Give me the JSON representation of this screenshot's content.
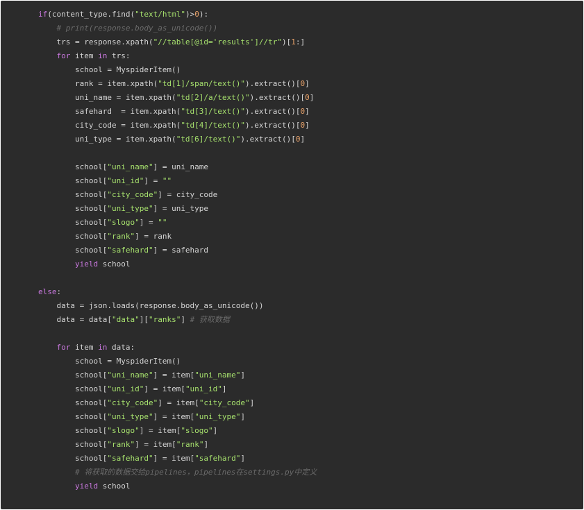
{
  "colors": {
    "background": "#2b2b2b",
    "plain": "#d4d4d4",
    "keyword": "#c777dc",
    "string": "#a6e06d",
    "number": "#e8a26a",
    "comment": "#6a6a6a"
  },
  "code_lines": [
    [
      [
        "keyword",
        "if"
      ],
      [
        "plain",
        "(content_type.find("
      ],
      [
        "string",
        "\"text/html\""
      ],
      [
        "plain",
        ")>"
      ],
      [
        "number",
        "0"
      ],
      [
        "plain",
        "):"
      ]
    ],
    [
      [
        "plain",
        "    "
      ],
      [
        "comment",
        "# print(response.body_as_unicode())"
      ]
    ],
    [
      [
        "plain",
        "    trs = response.xpath("
      ],
      [
        "string",
        "\"//table[@id='results']//tr\""
      ],
      [
        "plain",
        ")["
      ],
      [
        "number",
        "1"
      ],
      [
        "plain",
        ":]"
      ]
    ],
    [
      [
        "plain",
        "    "
      ],
      [
        "keyword",
        "for"
      ],
      [
        "plain",
        " item "
      ],
      [
        "keyword",
        "in"
      ],
      [
        "plain",
        " trs:"
      ]
    ],
    [
      [
        "plain",
        "        school = MyspiderItem()"
      ]
    ],
    [
      [
        "plain",
        "        rank = item.xpath("
      ],
      [
        "string",
        "\"td[1]/span/text()\""
      ],
      [
        "plain",
        ").extract()["
      ],
      [
        "number",
        "0"
      ],
      [
        "plain",
        "]"
      ]
    ],
    [
      [
        "plain",
        "        uni_name = item.xpath("
      ],
      [
        "string",
        "\"td[2]/a/text()\""
      ],
      [
        "plain",
        ").extract()["
      ],
      [
        "number",
        "0"
      ],
      [
        "plain",
        "]"
      ]
    ],
    [
      [
        "plain",
        "        safehard  = item.xpath("
      ],
      [
        "string",
        "\"td[3]/text()\""
      ],
      [
        "plain",
        ").extract()["
      ],
      [
        "number",
        "0"
      ],
      [
        "plain",
        "]"
      ]
    ],
    [
      [
        "plain",
        "        city_code = item.xpath("
      ],
      [
        "string",
        "\"td[4]/text()\""
      ],
      [
        "plain",
        ").extract()["
      ],
      [
        "number",
        "0"
      ],
      [
        "plain",
        "]"
      ]
    ],
    [
      [
        "plain",
        "        uni_type = item.xpath("
      ],
      [
        "string",
        "\"td[6]/text()\""
      ],
      [
        "plain",
        ").extract()["
      ],
      [
        "number",
        "0"
      ],
      [
        "plain",
        "]"
      ]
    ],
    [
      [
        "plain",
        ""
      ]
    ],
    [
      [
        "plain",
        "        school["
      ],
      [
        "string",
        "\"uni_name\""
      ],
      [
        "plain",
        "] = uni_name"
      ]
    ],
    [
      [
        "plain",
        "        school["
      ],
      [
        "string",
        "\"uni_id\""
      ],
      [
        "plain",
        "] = "
      ],
      [
        "string",
        "\"\""
      ]
    ],
    [
      [
        "plain",
        "        school["
      ],
      [
        "string",
        "\"city_code\""
      ],
      [
        "plain",
        "] = city_code"
      ]
    ],
    [
      [
        "plain",
        "        school["
      ],
      [
        "string",
        "\"uni_type\""
      ],
      [
        "plain",
        "] = uni_type"
      ]
    ],
    [
      [
        "plain",
        "        school["
      ],
      [
        "string",
        "\"slogo\""
      ],
      [
        "plain",
        "] = "
      ],
      [
        "string",
        "\"\""
      ]
    ],
    [
      [
        "plain",
        "        school["
      ],
      [
        "string",
        "\"rank\""
      ],
      [
        "plain",
        "] = rank"
      ]
    ],
    [
      [
        "plain",
        "        school["
      ],
      [
        "string",
        "\"safehard\""
      ],
      [
        "plain",
        "] = safehard"
      ]
    ],
    [
      [
        "plain",
        "        "
      ],
      [
        "keyword",
        "yield"
      ],
      [
        "plain",
        " school"
      ]
    ],
    [
      [
        "plain",
        ""
      ]
    ],
    [
      [
        "keyword",
        "else"
      ],
      [
        "plain",
        ":"
      ]
    ],
    [
      [
        "plain",
        "    data = json.loads(response.body_as_unicode())"
      ]
    ],
    [
      [
        "plain",
        "    data = data["
      ],
      [
        "string",
        "\"data\""
      ],
      [
        "plain",
        "]["
      ],
      [
        "string",
        "\"ranks\""
      ],
      [
        "plain",
        "] "
      ],
      [
        "comment",
        "# 获取数据"
      ]
    ],
    [
      [
        "plain",
        ""
      ]
    ],
    [
      [
        "plain",
        "    "
      ],
      [
        "keyword",
        "for"
      ],
      [
        "plain",
        " item "
      ],
      [
        "keyword",
        "in"
      ],
      [
        "plain",
        " data:"
      ]
    ],
    [
      [
        "plain",
        "        school = MyspiderItem()"
      ]
    ],
    [
      [
        "plain",
        "        school["
      ],
      [
        "string",
        "\"uni_name\""
      ],
      [
        "plain",
        "] = item["
      ],
      [
        "string",
        "\"uni_name\""
      ],
      [
        "plain",
        "]"
      ]
    ],
    [
      [
        "plain",
        "        school["
      ],
      [
        "string",
        "\"uni_id\""
      ],
      [
        "plain",
        "] = item["
      ],
      [
        "string",
        "\"uni_id\""
      ],
      [
        "plain",
        "]"
      ]
    ],
    [
      [
        "plain",
        "        school["
      ],
      [
        "string",
        "\"city_code\""
      ],
      [
        "plain",
        "] = item["
      ],
      [
        "string",
        "\"city_code\""
      ],
      [
        "plain",
        "]"
      ]
    ],
    [
      [
        "plain",
        "        school["
      ],
      [
        "string",
        "\"uni_type\""
      ],
      [
        "plain",
        "] = item["
      ],
      [
        "string",
        "\"uni_type\""
      ],
      [
        "plain",
        "]"
      ]
    ],
    [
      [
        "plain",
        "        school["
      ],
      [
        "string",
        "\"slogo\""
      ],
      [
        "plain",
        "] = item["
      ],
      [
        "string",
        "\"slogo\""
      ],
      [
        "plain",
        "]"
      ]
    ],
    [
      [
        "plain",
        "        school["
      ],
      [
        "string",
        "\"rank\""
      ],
      [
        "plain",
        "] = item["
      ],
      [
        "string",
        "\"rank\""
      ],
      [
        "plain",
        "]"
      ]
    ],
    [
      [
        "plain",
        "        school["
      ],
      [
        "string",
        "\"safehard\""
      ],
      [
        "plain",
        "] = item["
      ],
      [
        "string",
        "\"safehard\""
      ],
      [
        "plain",
        "]"
      ]
    ],
    [
      [
        "plain",
        "        "
      ],
      [
        "comment",
        "# 将获取的数据交给pipelines，pipelines在settings.py中定义"
      ]
    ],
    [
      [
        "plain",
        "        "
      ],
      [
        "keyword",
        "yield"
      ],
      [
        "plain",
        " school"
      ]
    ]
  ]
}
